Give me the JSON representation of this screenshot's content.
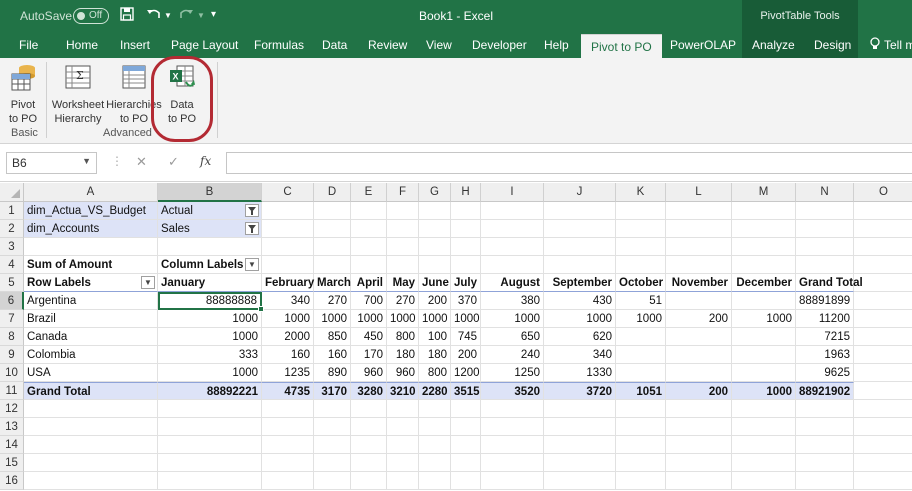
{
  "titlebar": {
    "autosave_label": "AutoSave",
    "autosave_state": "Off",
    "title": "Book1  -  Excel",
    "context_group": "PivotTable Tools"
  },
  "tabs": [
    {
      "label": "File"
    },
    {
      "label": "Home"
    },
    {
      "label": "Insert"
    },
    {
      "label": "Page Layout"
    },
    {
      "label": "Formulas"
    },
    {
      "label": "Data"
    },
    {
      "label": "Review"
    },
    {
      "label": "View"
    },
    {
      "label": "Developer"
    },
    {
      "label": "Help"
    },
    {
      "label": "Pivot to PO"
    },
    {
      "label": "PowerOLAP"
    },
    {
      "label": "Analyze"
    },
    {
      "label": "Design"
    },
    {
      "label": "Tell m"
    }
  ],
  "active_tab": "Pivot to PO",
  "ribbon": {
    "buttons": [
      {
        "label1": "Pivot",
        "label2": "to PO",
        "icon": "pivot-to-po-icon"
      },
      {
        "label1": "Worksheet",
        "label2": "Hierarchy",
        "icon": "worksheet-hierarchy-icon"
      },
      {
        "label1": "Hierarchies",
        "label2": "to PO",
        "icon": "hierarchies-icon"
      },
      {
        "label1": "Data",
        "label2": "to PO",
        "icon": "excel-data-icon"
      }
    ],
    "groups": [
      {
        "label": "Basic"
      },
      {
        "label": "Advanced"
      }
    ]
  },
  "formula_bar": {
    "name_box": "B6",
    "formula": "",
    "fx_label": "fx"
  },
  "columns": [
    "A",
    "B",
    "C",
    "D",
    "E",
    "F",
    "G",
    "H",
    "I",
    "J",
    "K",
    "L",
    "M",
    "N",
    "O"
  ],
  "rows": [
    "1",
    "2",
    "3",
    "4",
    "5",
    "6",
    "7",
    "8",
    "9",
    "10",
    "11",
    "12",
    "13",
    "14",
    "15",
    "16"
  ],
  "pivot": {
    "filters": [
      {
        "field": "dim_Actua_VS_Budget",
        "value": "Actual"
      },
      {
        "field": "dim_Accounts",
        "value": "Sales"
      }
    ],
    "measure_label": "Sum of Amount",
    "column_labels": "Column Labels",
    "row_labels": "Row Labels",
    "months": [
      "January",
      "February",
      "March",
      "April",
      "May",
      "June",
      "July",
      "August",
      "September",
      "October",
      "November",
      "December",
      "Grand Total"
    ],
    "data_rows": [
      {
        "label": "Argentina",
        "values": [
          "88888888",
          "340",
          "270",
          "700",
          "270",
          "200",
          "370",
          "380",
          "430",
          "51",
          "",
          "",
          "88891899"
        ]
      },
      {
        "label": "Brazil",
        "values": [
          "1000",
          "1000",
          "1000",
          "1000",
          "1000",
          "1000",
          "1000",
          "1000",
          "1000",
          "1000",
          "200",
          "1000",
          "11200"
        ]
      },
      {
        "label": "Canada",
        "values": [
          "1000",
          "2000",
          "850",
          "450",
          "800",
          "100",
          "745",
          "650",
          "620",
          "",
          "",
          "",
          "7215"
        ]
      },
      {
        "label": "Colombia",
        "values": [
          "333",
          "160",
          "160",
          "170",
          "180",
          "180",
          "200",
          "240",
          "340",
          "",
          "",
          "",
          "1963"
        ]
      },
      {
        "label": "USA",
        "values": [
          "1000",
          "1235",
          "890",
          "960",
          "960",
          "800",
          "1200",
          "1250",
          "1330",
          "",
          "",
          "",
          "9625"
        ]
      }
    ],
    "grand_total": {
      "label": "Grand Total",
      "values": [
        "88892221",
        "4735",
        "3170",
        "3280",
        "3210",
        "2280",
        "3515",
        "3520",
        "3720",
        "1051",
        "200",
        "1000",
        "88921902"
      ]
    }
  }
}
